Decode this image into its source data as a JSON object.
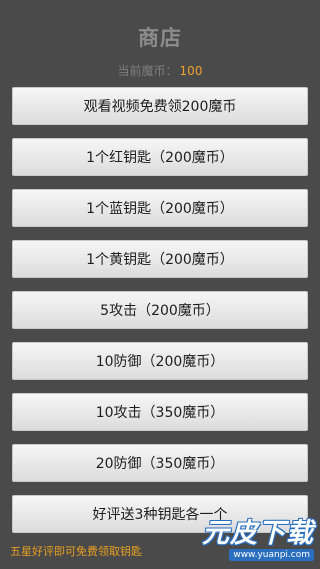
{
  "header": {
    "title": "商店",
    "coins_label": "当前魔币：",
    "coins_value": "100"
  },
  "buttons": [
    "观看视频免费领200魔币",
    "1个红钥匙（200魔币）",
    "1个蓝钥匙（200魔币）",
    "1个黄钥匙（200魔币）",
    "5攻击（200魔币）",
    "10防御（200魔币）",
    "10攻击（350魔币）",
    "20防御（350魔币）",
    "好评送3种钥匙各一个"
  ],
  "footer": {
    "text": "五星好评即可免费领取钥匙"
  },
  "watermark": {
    "logo": "元皮下载",
    "url": "www.yuanpi.com"
  },
  "colors": {
    "background": "#4a4a4a",
    "coin_value": "#f0a030",
    "footer_text": "#e8a020"
  }
}
